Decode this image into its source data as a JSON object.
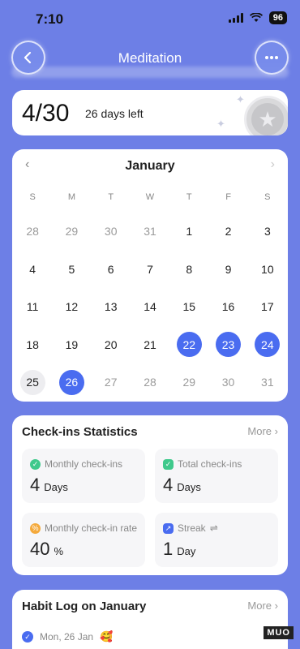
{
  "status": {
    "time": "7:10",
    "battery": "96"
  },
  "header": {
    "title": "Meditation"
  },
  "progress": {
    "count": "4/30",
    "days_left": "26 days left"
  },
  "calendar": {
    "month": "January",
    "weekdays": [
      "S",
      "M",
      "T",
      "W",
      "T",
      "F",
      "S"
    ],
    "days": [
      {
        "n": "28",
        "state": "muted"
      },
      {
        "n": "29",
        "state": "muted"
      },
      {
        "n": "30",
        "state": "muted"
      },
      {
        "n": "31",
        "state": "muted"
      },
      {
        "n": "1",
        "state": ""
      },
      {
        "n": "2",
        "state": ""
      },
      {
        "n": "3",
        "state": ""
      },
      {
        "n": "4",
        "state": ""
      },
      {
        "n": "5",
        "state": ""
      },
      {
        "n": "6",
        "state": ""
      },
      {
        "n": "7",
        "state": ""
      },
      {
        "n": "8",
        "state": ""
      },
      {
        "n": "9",
        "state": ""
      },
      {
        "n": "10",
        "state": ""
      },
      {
        "n": "11",
        "state": ""
      },
      {
        "n": "12",
        "state": ""
      },
      {
        "n": "13",
        "state": ""
      },
      {
        "n": "14",
        "state": ""
      },
      {
        "n": "15",
        "state": ""
      },
      {
        "n": "16",
        "state": ""
      },
      {
        "n": "17",
        "state": ""
      },
      {
        "n": "18",
        "state": ""
      },
      {
        "n": "19",
        "state": ""
      },
      {
        "n": "20",
        "state": ""
      },
      {
        "n": "21",
        "state": ""
      },
      {
        "n": "22",
        "state": "checked"
      },
      {
        "n": "23",
        "state": "checked"
      },
      {
        "n": "24",
        "state": "checked"
      },
      {
        "n": "25",
        "state": "today"
      },
      {
        "n": "26",
        "state": "checked"
      },
      {
        "n": "27",
        "state": "muted"
      },
      {
        "n": "28",
        "state": "muted"
      },
      {
        "n": "29",
        "state": "muted"
      },
      {
        "n": "30",
        "state": "muted"
      },
      {
        "n": "31",
        "state": "muted"
      }
    ]
  },
  "stats": {
    "title": "Check-ins Statistics",
    "more": "More",
    "monthly_checkins": {
      "label": "Monthly check-ins",
      "value": "4",
      "unit": "Days"
    },
    "total_checkins": {
      "label": "Total check-ins",
      "value": "4",
      "unit": "Days"
    },
    "monthly_rate": {
      "label": "Monthly check-in rate",
      "value": "40",
      "unit": "%"
    },
    "streak": {
      "label": "Streak",
      "value": "1",
      "unit": "Day"
    }
  },
  "log": {
    "title": "Habit Log on January",
    "more": "More",
    "entry_date": "Mon, 26 Jan",
    "entry_emoji": "🥰"
  },
  "watermark": "MUO",
  "colors": {
    "background": "#6d7fe6",
    "accent": "#4a6cf0",
    "tile": "#f6f6f8"
  }
}
